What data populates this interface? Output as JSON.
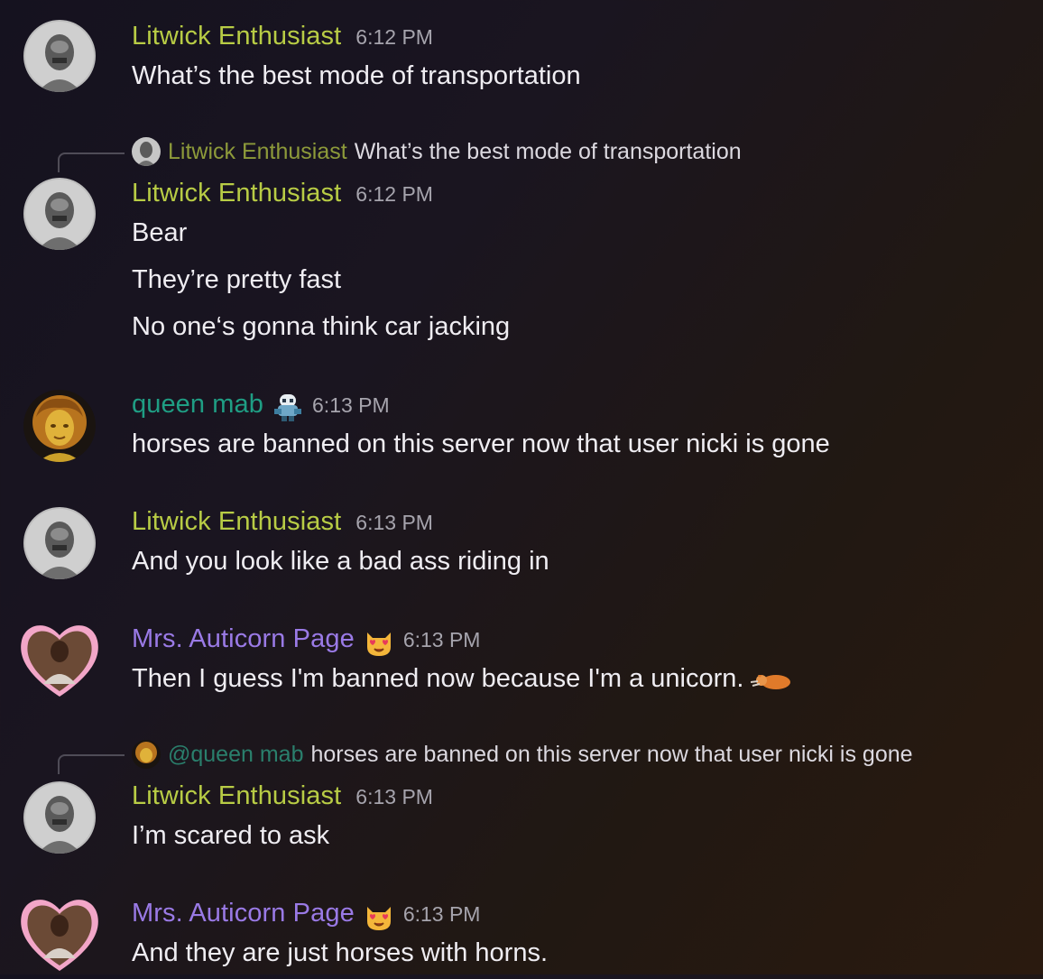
{
  "messages": [
    {
      "username": "Litwick Enthusiast",
      "time": "6:12 PM",
      "lines": [
        "What’s the best mode of transportation"
      ]
    },
    {
      "reply_to": {
        "username": "Litwick Enthusiast",
        "text": "What’s the best mode of transportation"
      },
      "username": "Litwick Enthusiast",
      "time": "6:12 PM",
      "lines": [
        "Bear",
        "They’re pretty fast",
        "No one‘s gonna think car jacking"
      ]
    },
    {
      "username": "queen mab",
      "badge_icon": "pokemon-sprite-icon",
      "time": "6:13 PM",
      "lines": [
        "horses are banned on this server now that user nicki is gone"
      ]
    },
    {
      "username": "Litwick Enthusiast",
      "time": "6:13 PM",
      "lines": [
        "And you look like a bad ass riding in"
      ]
    },
    {
      "username": "Mrs. Auticorn Page",
      "badge_icon": "heart-eyes-cat-emoji",
      "time": "6:13 PM",
      "lines": [
        "Then I guess I'm banned now because I'm a unicorn."
      ],
      "trailing_emoji": "sliding-cat-emoji"
    },
    {
      "reply_to": {
        "username": "@queen mab",
        "text": "horses are banned on this server now that user nicki is gone"
      },
      "username": "Litwick Enthusiast",
      "time": "6:13 PM",
      "lines": [
        "I’m scared to ask"
      ]
    },
    {
      "username": "Mrs. Auticorn Page",
      "badge_icon": "heart-eyes-cat-emoji",
      "time": "6:13 PM",
      "lines": [
        "And they are just horses with horns."
      ]
    }
  ],
  "colors": {
    "litwick": "#b8cc45",
    "queen_mab": "#1f9e84",
    "mrs_auticorn": "#9a7ae6",
    "timestamp": "#a6a4ad"
  }
}
